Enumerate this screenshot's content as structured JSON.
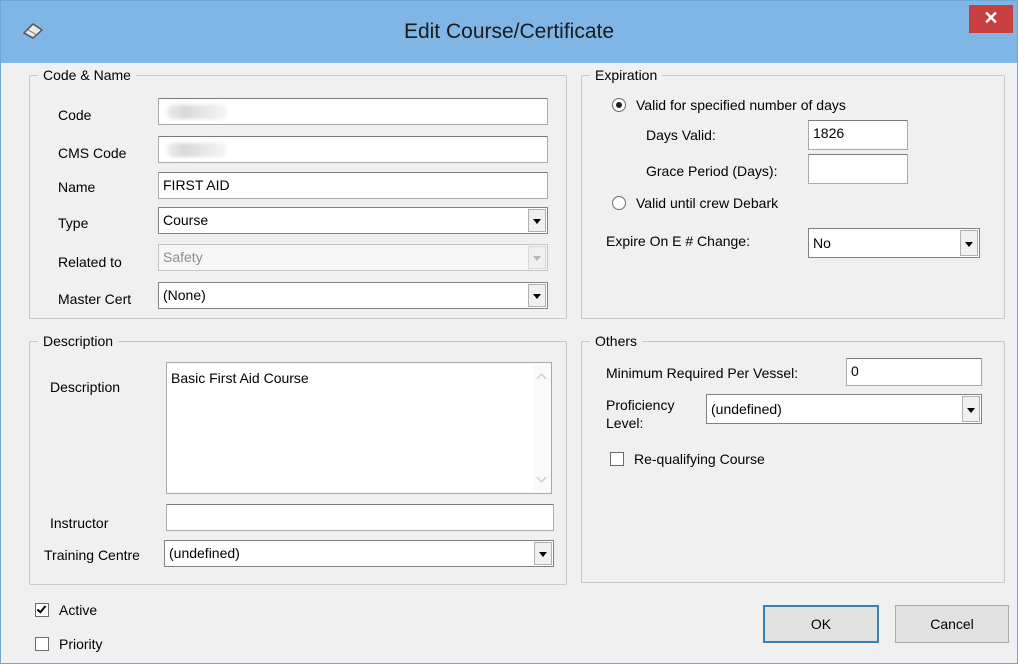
{
  "window": {
    "title": "Edit Course/Certificate",
    "icon": "eraser-icon",
    "close_glyph": "✕"
  },
  "code_name": {
    "legend": "Code & Name",
    "code_label": "Code",
    "code_value": "",
    "cms_code_label": "CMS Code",
    "cms_code_value": "",
    "name_label": "Name",
    "name_value": "FIRST AID",
    "type_label": "Type",
    "type_value": "Course",
    "related_label": "Related to",
    "related_value": "Safety",
    "master_label": "Master Cert",
    "master_value": "(None)"
  },
  "description": {
    "legend": "Description",
    "description_label": "Description",
    "description_value": "Basic First Aid Course",
    "instructor_label": "Instructor",
    "instructor_value": "",
    "training_label": "Training Centre",
    "training_value": "(undefined)"
  },
  "expiration": {
    "legend": "Expiration",
    "option_days_label": "Valid for specified number of days",
    "option_days_selected": true,
    "days_valid_label": "Days Valid:",
    "days_valid_value": "1826",
    "grace_label": "Grace Period (Days):",
    "grace_value": "",
    "option_debark_label": "Valid until crew Debark",
    "option_debark_selected": false,
    "expire_label": "Expire On E # Change:",
    "expire_value": "No"
  },
  "others": {
    "legend": "Others",
    "min_required_label": "Minimum Required Per Vessel:",
    "min_required_value": "0",
    "proficiency_label_1": "Proficiency",
    "proficiency_label_2": "Level:",
    "proficiency_value": "(undefined)",
    "requalifying_label": "Re-qualifying Course",
    "requalifying_checked": false
  },
  "flags": {
    "active_label": "Active",
    "active_checked": true,
    "priority_label": "Priority",
    "priority_checked": false
  },
  "buttons": {
    "ok_label": "OK",
    "cancel_label": "Cancel"
  },
  "colors": {
    "titlebar": "#7fb6e6",
    "close_button": "#c7403f",
    "dialog_background": "#f0f0f0",
    "default_button_border": "#3c7fb1"
  }
}
